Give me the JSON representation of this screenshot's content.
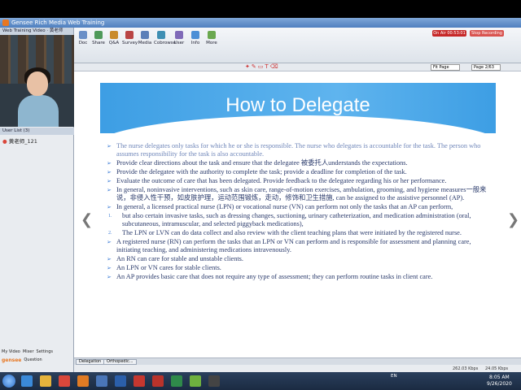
{
  "window": {
    "title": "Gensee Rich Media Web Training"
  },
  "left_panel": {
    "video_header": "Web Training Video · 黄老师_121",
    "user_list_header": "User List (3)",
    "user_item": "黄老师_121",
    "footer_buttons": [
      "My Video",
      "Mixer",
      "Settings"
    ],
    "brand": "gensee",
    "question_label": "Question"
  },
  "toolbar": {
    "buttons": [
      {
        "label": "Doc",
        "color": "#6a8fc7"
      },
      {
        "label": "Share",
        "color": "#4f9a5a"
      },
      {
        "label": "Q&A",
        "color": "#c98b2b"
      },
      {
        "label": "Survey",
        "color": "#b94545"
      },
      {
        "label": "Media",
        "color": "#5b7fb8"
      },
      {
        "label": "Cobrowse",
        "color": "#3f8fb3"
      },
      {
        "label": "User",
        "color": "#7f6ab8"
      },
      {
        "label": "Info",
        "color": "#4b8fd6"
      },
      {
        "label": "More",
        "color": "#6aa84f"
      }
    ],
    "record_label": "On Air 00:53:01",
    "stop_label": "Stop Recording"
  },
  "subbar": {
    "zoom_value": "Fit Page",
    "page_value": "Page 2/63"
  },
  "slide": {
    "title": "How to Delegate",
    "bullets": [
      {
        "marker": "➢",
        "text": "The nurse delegates only tasks for which he or she is responsible. The nurse who delegates is accountable for the task. The person who assumes responsibility for the task is also accountable.",
        "style": "faded"
      },
      {
        "marker": "➢",
        "text": "Provide clear directions about the task and ensure that the delegatee 被委托人understands the expectations.",
        "style": ""
      },
      {
        "marker": "➢",
        "text": "Provide the delegatee with the authority to complete the task; provide a deadline for completion of the task.",
        "style": ""
      },
      {
        "marker": "➢",
        "text": "Evaluate the outcome of care that has been delegated. Provide feedback to the delegatee regarding his or her performance.",
        "style": ""
      },
      {
        "marker": "➢",
        "text": "In general, noninvasive interventions, such as skin care, range-of-motion exercises, ambulation, grooming, and hygiene measures一般来说，非侵入性干预，如皮肤护理，运动范围锻炼，走动，修饰和卫生措施, can be assigned to the assistive personnel (AP).",
        "style": ""
      },
      {
        "marker": "➢",
        "text": "In general, a licensed practical nurse (LPN) or vocational nurse (VN) can perform not only the tasks that an AP can perform,",
        "style": ""
      },
      {
        "marker": "1.",
        "text": "but also certain invasive tasks, such as dressing changes, suctioning, urinary catheterization, and medication administration (oral, subcutaneous, intramuscular, and selected piggyback medications),",
        "style": "sub"
      },
      {
        "marker": "2.",
        "text": "The LPN or LVN can do data collect and also review with the client teaching plans that were initiated by the registered nurse.",
        "style": "sub"
      },
      {
        "marker": "➢",
        "text": "A registered nurse (RN) can perform the tasks that an LPN or VN can perform and is responsible for assessment and planning care, initiating teaching, and administering medications intravenously.",
        "style": ""
      },
      {
        "marker": "➢",
        "text": "An RN can care for stable and unstable clients.",
        "style": ""
      },
      {
        "marker": "➢",
        "text": "An LPN or VN cares for stable clients.",
        "style": ""
      },
      {
        "marker": "➢",
        "text": "An AP provides basic care that does not require any type of assessment; they can perform routine tasks in client care.",
        "style": ""
      }
    ]
  },
  "tabs": [
    "Delegation",
    "Orthopedic..."
  ],
  "status": {
    "rate_down": "262.03 Kbps",
    "rate_up": "24.05 Kbps"
  },
  "taskbar": {
    "apps": [
      {
        "name": "ie",
        "color": "#3b8ad9"
      },
      {
        "name": "folder",
        "color": "#e5b33c"
      },
      {
        "name": "chrome",
        "color": "#d9473b"
      },
      {
        "name": "media",
        "color": "#e07b24"
      },
      {
        "name": "explorer",
        "color": "#4a76b8"
      },
      {
        "name": "word",
        "color": "#2b5faa"
      },
      {
        "name": "pdf",
        "color": "#c6372f"
      },
      {
        "name": "pdf2",
        "color": "#b9332b"
      },
      {
        "name": "excel",
        "color": "#2f8a4a"
      },
      {
        "name": "gensee",
        "color": "#6fb13f"
      },
      {
        "name": "app",
        "color": "#444"
      }
    ],
    "tray_lang": "EN",
    "time": "8:05 AM",
    "date": "9/26/2020"
  }
}
